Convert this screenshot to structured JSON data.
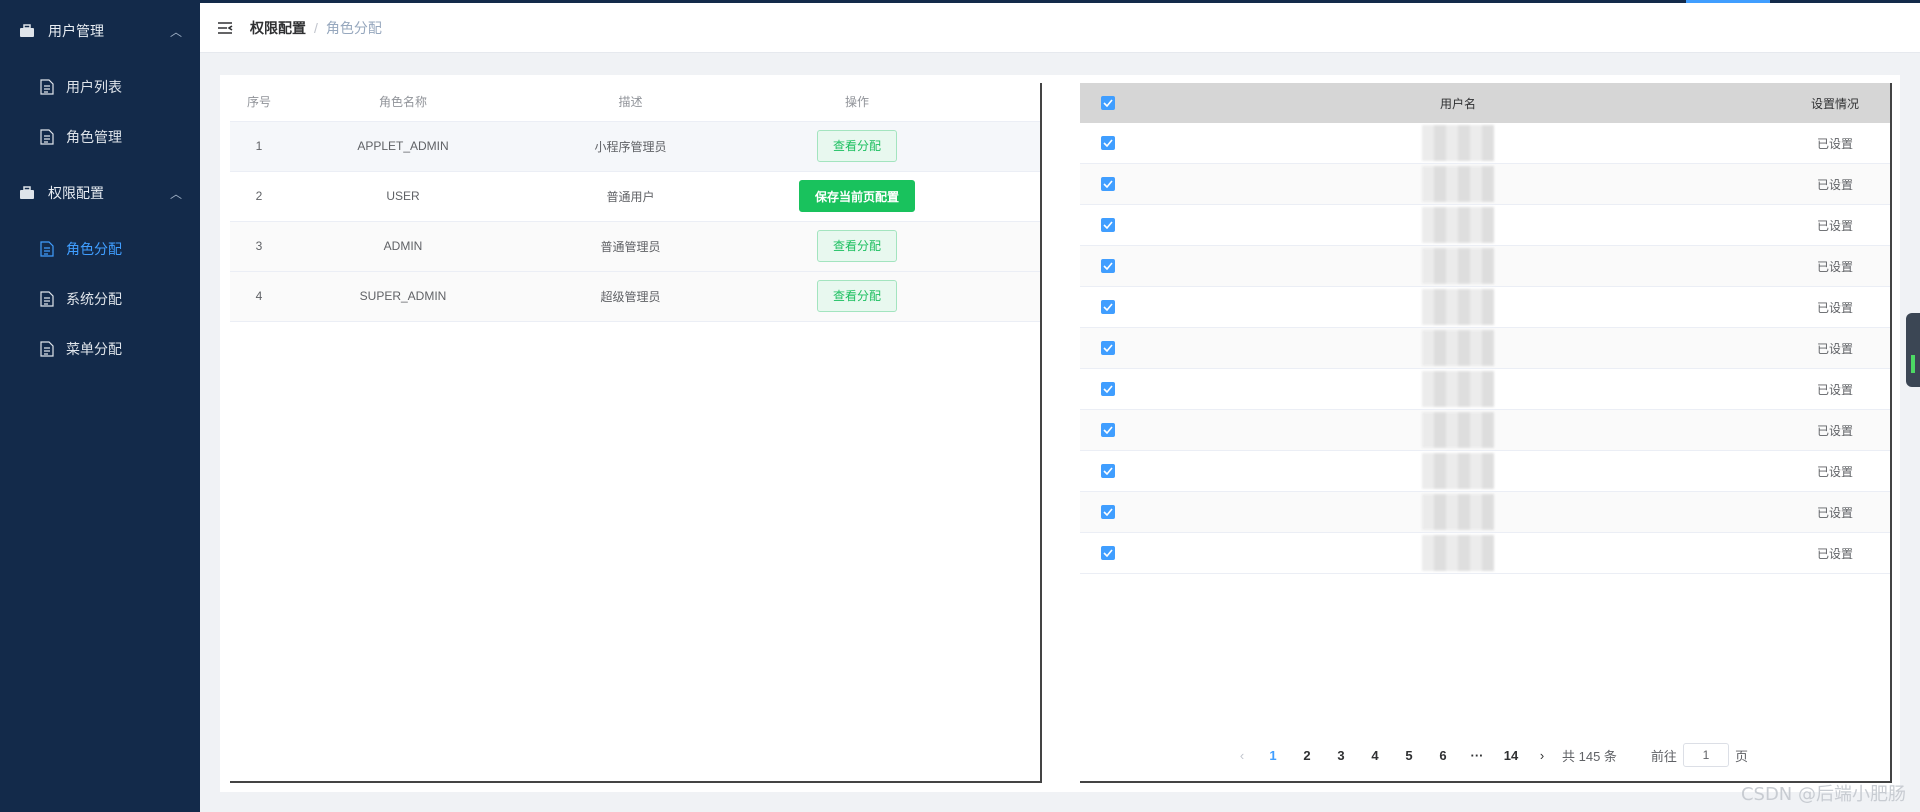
{
  "sidebar": {
    "groups": [
      {
        "label": "用户管理",
        "items": [
          {
            "label": "用户列表"
          },
          {
            "label": "角色管理"
          }
        ]
      },
      {
        "label": "权限配置",
        "items": [
          {
            "label": "角色分配"
          },
          {
            "label": "系统分配"
          },
          {
            "label": "菜单分配"
          }
        ]
      }
    ]
  },
  "header": {
    "breadcrumb": [
      "权限配置",
      "角色分配"
    ],
    "separator": "/"
  },
  "role_table": {
    "columns": [
      "序号",
      "角色名称",
      "描述",
      "操作"
    ],
    "rows": [
      {
        "index": "1",
        "name": "APPLET_ADMIN",
        "desc": "小程序管理员",
        "action": "查看分配"
      },
      {
        "index": "2",
        "name": "USER",
        "desc": "普通用户",
        "action": "保存当前页配置"
      },
      {
        "index": "3",
        "name": "ADMIN",
        "desc": "普通管理员",
        "action": "查看分配"
      },
      {
        "index": "4",
        "name": "SUPER_ADMIN",
        "desc": "超级管理员",
        "action": "查看分配"
      }
    ]
  },
  "user_table": {
    "columns": [
      "用户名",
      "设置情况"
    ],
    "status_text": "已设置",
    "row_count": 11
  },
  "pagination": {
    "pages": [
      "1",
      "2",
      "3",
      "4",
      "5",
      "6",
      "···",
      "14"
    ],
    "current": "1",
    "total_text": "共 145 条",
    "goto_prefix": "前往",
    "goto_value": "1",
    "goto_suffix": "页"
  },
  "watermark": "CSDN @后端小肥肠",
  "colors": {
    "sidebar_bg": "#132a4a",
    "active": "#409eff",
    "success": "#19c25d"
  }
}
